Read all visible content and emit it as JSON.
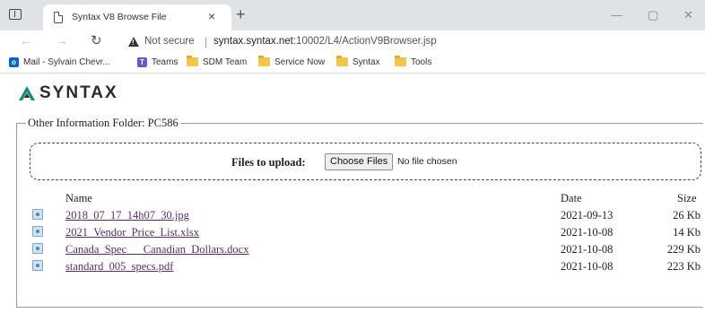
{
  "browser": {
    "tab_title": "Syntax V8 Browse File",
    "tab_close": "×",
    "new_tab": "+",
    "win_minimize": "—",
    "win_maximize": "▢",
    "win_close": "✕",
    "security_label": "Not secure",
    "url_host": "syntax.syntax.net",
    "url_rest": ":10002/L4/ActionV9Browser.jsp",
    "bookmarks": [
      {
        "label": "Mail - Sylvain Chevr...",
        "icon": "outlook-icon"
      },
      {
        "label": "Teams",
        "icon": "teams-icon"
      },
      {
        "label": "SDM Team",
        "icon": "folder-icon"
      },
      {
        "label": "Service Now",
        "icon": "folder-icon"
      },
      {
        "label": "Syntax",
        "icon": "folder-icon"
      },
      {
        "label": "Tools",
        "icon": "folder-icon"
      }
    ]
  },
  "page": {
    "logo_text": "SYNTAX",
    "logo_color": "#1d8a7a",
    "folder_legend": "Other Information Folder: PC586",
    "upload": {
      "label": "Files to upload:",
      "button": "Choose Files",
      "status": "No file chosen"
    },
    "table": {
      "headers": {
        "name": "Name",
        "date": "Date",
        "size": "Size"
      },
      "files": [
        {
          "name": "2018_07_17_14h07_30.jpg",
          "date": "2021-09-13",
          "size": "26 Kb"
        },
        {
          "name": "2021_Vendor_Price_List.xlsx",
          "date": "2021-10-08",
          "size": "14 Kb"
        },
        {
          "name": "Canada_Spec___Canadian_Dollars.docx",
          "date": "2021-10-08",
          "size": "229 Kb"
        },
        {
          "name": "standard_005_specs.pdf",
          "date": "2021-10-08",
          "size": "223 Kb"
        }
      ]
    }
  }
}
